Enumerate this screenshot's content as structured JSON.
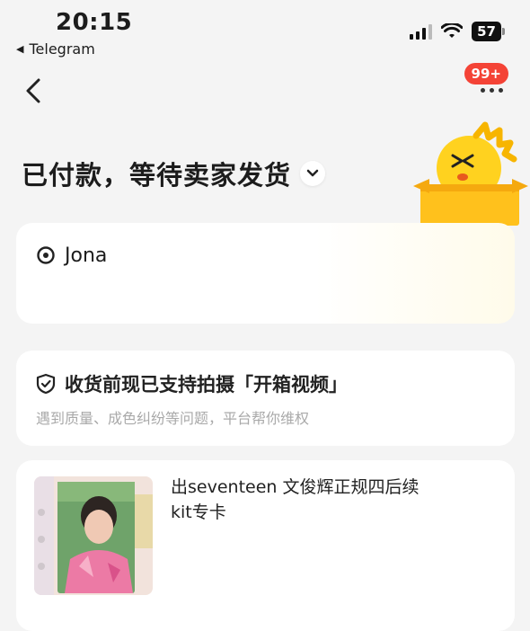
{
  "status_bar": {
    "time": "20:15",
    "back_app_label": "Telegram",
    "battery": "57"
  },
  "nav": {
    "back_icon": "chevron-left-icon",
    "badge_count": "99+",
    "more_icon": "more-dots-icon"
  },
  "order": {
    "status_title": "已付款，等待卖家发货",
    "status_toggle_icon": "chevron-down-icon"
  },
  "address": {
    "icon": "location-pin-icon",
    "name": "Jona"
  },
  "unboxing_notice": {
    "icon": "shield-check-icon",
    "title": "收货前现已支持拍摄「开箱视频」",
    "subtitle": "遇到质量、成色纠纷等问题，平台帮你维权"
  },
  "item": {
    "title": "出seventeen 文俊辉正规四后续kit专卡"
  },
  "colors": {
    "background": "#f4f4f4",
    "card": "#ffffff",
    "badge": "#f44336",
    "mascot_yellow": "#ffd21f",
    "muted_text": "#a9a9a9"
  }
}
